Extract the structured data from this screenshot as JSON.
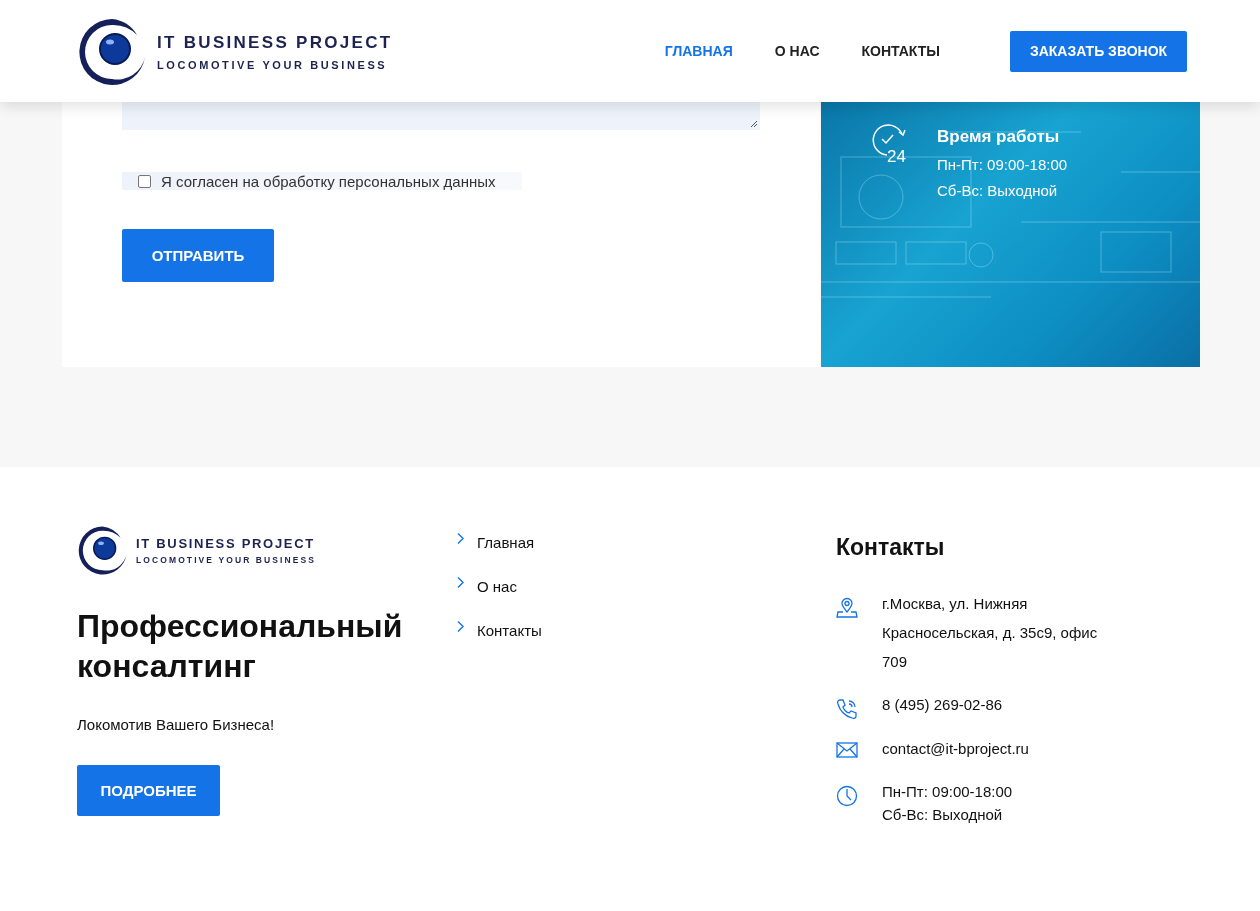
{
  "header": {
    "logo": {
      "title": "IT BUSINESS PROJECT",
      "tagline": "LOCOMOTIVE YOUR BUSINESS"
    },
    "nav": [
      {
        "label": "ГЛАВНАЯ",
        "selected": true
      },
      {
        "label": "О НАС",
        "selected": false
      },
      {
        "label": "КОНТАКТЫ",
        "selected": false
      }
    ],
    "cta": "ЗАКАЗАТЬ ЗВОНОК"
  },
  "form": {
    "consent": {
      "label": "Я согласен на обработку персональных данных",
      "checked": false
    },
    "submit": "ОТПРАВИТЬ"
  },
  "hours_card": {
    "icon_text": "24",
    "title": "Время работы",
    "lines": [
      "Пн-Пт: 09:00-18:00",
      "Сб-Вс: Выходной"
    ]
  },
  "footer": {
    "logo": {
      "title": "IT BUSINESS PROJECT",
      "tagline": "LOCOMOTIVE YOUR BUSINESS"
    },
    "heading": "Профессиональный консалтинг",
    "tagline": "Локомотив Вашего Бизнеса!",
    "button": "ПОДРОБНЕЕ",
    "links": [
      "Главная",
      "О нас",
      "Контакты"
    ],
    "contacts": {
      "title": "Контакты",
      "items": [
        {
          "kind": "address",
          "lines": [
            "г.Москва, ул. Нижняя Красносельская, д. 35с9, офис 709"
          ]
        },
        {
          "kind": "phone",
          "lines": [
            "8 (495) 269-02-86"
          ]
        },
        {
          "kind": "email",
          "lines": [
            "contact@it-bproject.ru"
          ]
        },
        {
          "kind": "hours",
          "lines": [
            "Пн-Пт: 09:00-18:00",
            "Сб-Вс: Выходной"
          ]
        }
      ]
    }
  }
}
